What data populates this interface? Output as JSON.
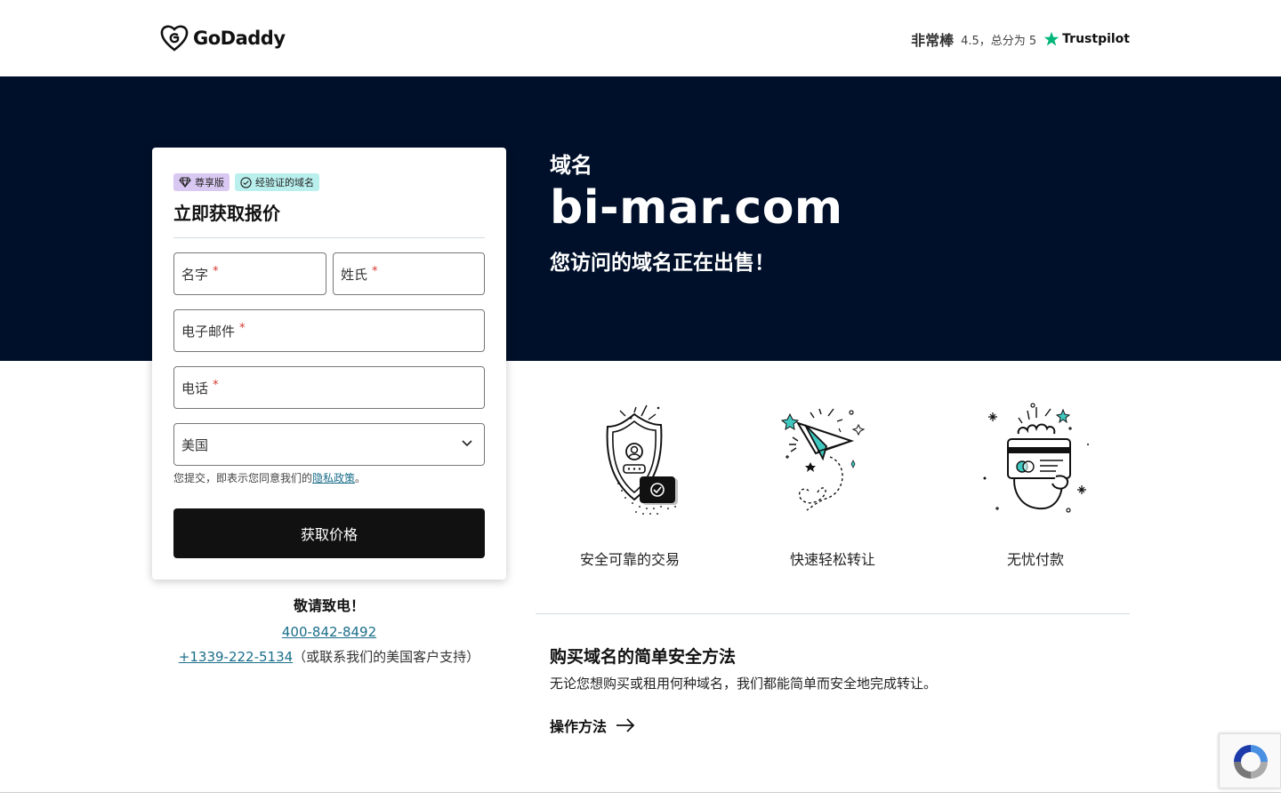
{
  "header": {
    "brand": "GoDaddy",
    "rating_label": "非常棒",
    "rating_score": "4.5，总分为 5",
    "rating_source": "Trustpilot"
  },
  "hero": {
    "category": "域名",
    "domain": "bi-mar.com",
    "subtitle": "您访问的域名正在出售！"
  },
  "form": {
    "badge_premium": "尊享版",
    "badge_verified": "经验证的域名",
    "title": "立即获取报价",
    "first_name_label": "名字",
    "last_name_label": "姓氏",
    "email_label": "电子邮件",
    "phone_label": "电话",
    "required_mark": "*",
    "country_value": "美国",
    "consent_text": "您提交，即表示您同意我们的",
    "privacy_link": "隐私政策",
    "consent_end": "。",
    "submit_label": "获取价格"
  },
  "contact": {
    "title": "敬请致电！",
    "phone": "400-842-8492",
    "intl_phone": "+1339-222-5134",
    "intl_note": "（或联系我们的美国客户支持）"
  },
  "features": [
    {
      "label": "安全可靠的交易",
      "icon": "shield-icon"
    },
    {
      "label": "快速轻松转让",
      "icon": "paper-plane-icon"
    },
    {
      "label": "无忧付款",
      "icon": "card-payment-icon"
    }
  ],
  "how": {
    "title": "购买域名的简单安全方法",
    "description": "无论您想购买或租用何种域名，我们都能简单而安全地完成转让。",
    "link_label": "操作方法"
  },
  "colors": {
    "hero_bg": "#00102a",
    "link": "#1b6e8a",
    "button": "#111111",
    "trustpilot_star": "#00b67a"
  }
}
